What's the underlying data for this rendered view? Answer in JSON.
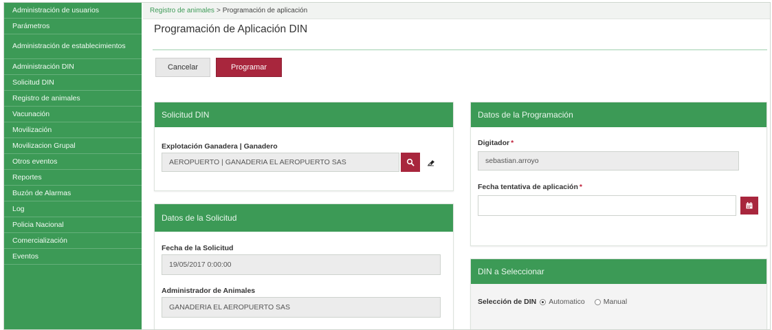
{
  "sidebar": {
    "items": [
      {
        "label": "Administración de usuarios",
        "rows": 1
      },
      {
        "label": "Parámetros",
        "rows": 1
      },
      {
        "label": "Administración de establecimientos",
        "rows": 2
      },
      {
        "label": "Administración DIN",
        "rows": 1
      },
      {
        "label": "Solicitud DIN",
        "rows": 1
      },
      {
        "label": "Registro de animales",
        "rows": 1
      },
      {
        "label": "Vacunación",
        "rows": 1
      },
      {
        "label": "Movilización",
        "rows": 1
      },
      {
        "label": "Movilizacion Grupal",
        "rows": 1
      },
      {
        "label": "Otros eventos",
        "rows": 1
      },
      {
        "label": "Reportes",
        "rows": 1
      },
      {
        "label": "Buzón de Alarmas",
        "rows": 1
      },
      {
        "label": "Log",
        "rows": 1
      },
      {
        "label": "Policia Nacional",
        "rows": 1
      },
      {
        "label": "Comercialización",
        "rows": 1
      },
      {
        "label": "Eventos",
        "rows": 1
      }
    ]
  },
  "breadcrumb": {
    "link": "Registro de animales",
    "separator": ">",
    "current": "Programación de aplicación"
  },
  "page": {
    "title": "Programación de Aplicación DIN"
  },
  "toolbar": {
    "cancel_label": "Cancelar",
    "program_label": "Programar"
  },
  "solicitud_din": {
    "heading": "Solicitud DIN",
    "explotacion_label": "Explotación Ganadera | Ganadero",
    "explotacion_value": "AEROPUERTO | GANADERIA EL AEROPUERTO SAS"
  },
  "datos_solicitud": {
    "heading": "Datos de la Solicitud",
    "fecha_label": "Fecha de la Solicitud",
    "fecha_value": "19/05/2017 0:00:00",
    "admin_label": "Administrador de Animales",
    "admin_value": "GANADERIA EL AEROPUERTO SAS"
  },
  "datos_programacion": {
    "heading": "Datos de la Programación",
    "digitador_label": "Digitador",
    "digitador_value": "sebastian.arroyo",
    "fecha_tentativa_label": "Fecha tentativa de aplicación",
    "fecha_tentativa_value": "",
    "required_mark": "*"
  },
  "din_seleccionar": {
    "heading": "DIN a Seleccionar",
    "selection_label": "Selección de DIN",
    "options": [
      "Automatico",
      "Manual"
    ],
    "selected": "Automatico"
  },
  "icons": {
    "search": "search-icon",
    "eraser": "eraser-icon",
    "calendar": "calendar-icon"
  },
  "colors": {
    "sidebar_green": "#3c9a56",
    "primary_red": "#a8263d"
  }
}
